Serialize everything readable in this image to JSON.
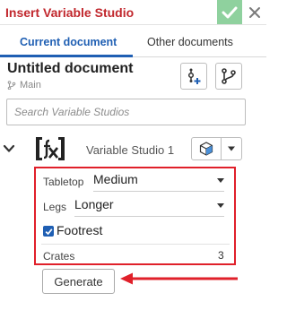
{
  "dialog": {
    "title": "Insert Variable Studio"
  },
  "tabs": [
    {
      "label": "Current document",
      "active": true
    },
    {
      "label": "Other documents",
      "active": false
    }
  ],
  "document": {
    "title": "Untitled document",
    "branch": "Main"
  },
  "search": {
    "placeholder": "Search Variable Studios"
  },
  "studio": {
    "name": "Variable Studio 1"
  },
  "parameters": {
    "tabletop_label": "Tabletop",
    "tabletop_value": "Medium",
    "legs_label": "Legs",
    "legs_value": "Longer",
    "footrest_label": "Footrest",
    "footrest_checked": true,
    "crates_label": "Crates",
    "crates_value": "3"
  },
  "actions": {
    "generate_label": "Generate"
  },
  "colors": {
    "title_red": "#c1272d",
    "accent_blue": "#1f5fb3",
    "ok_green": "#8fd19e",
    "highlight_red": "#e0202a"
  },
  "icons": {
    "ok": "checkmark-icon",
    "close": "close-icon",
    "branch": "branch-icon",
    "insert_config": "insert-configuration-icon",
    "versions": "versions-graph-icon",
    "studio": "variable-studio-icon",
    "part": "part-cube-icon",
    "dropdown": "caret-down-icon",
    "collapse": "chevron-down-icon"
  }
}
